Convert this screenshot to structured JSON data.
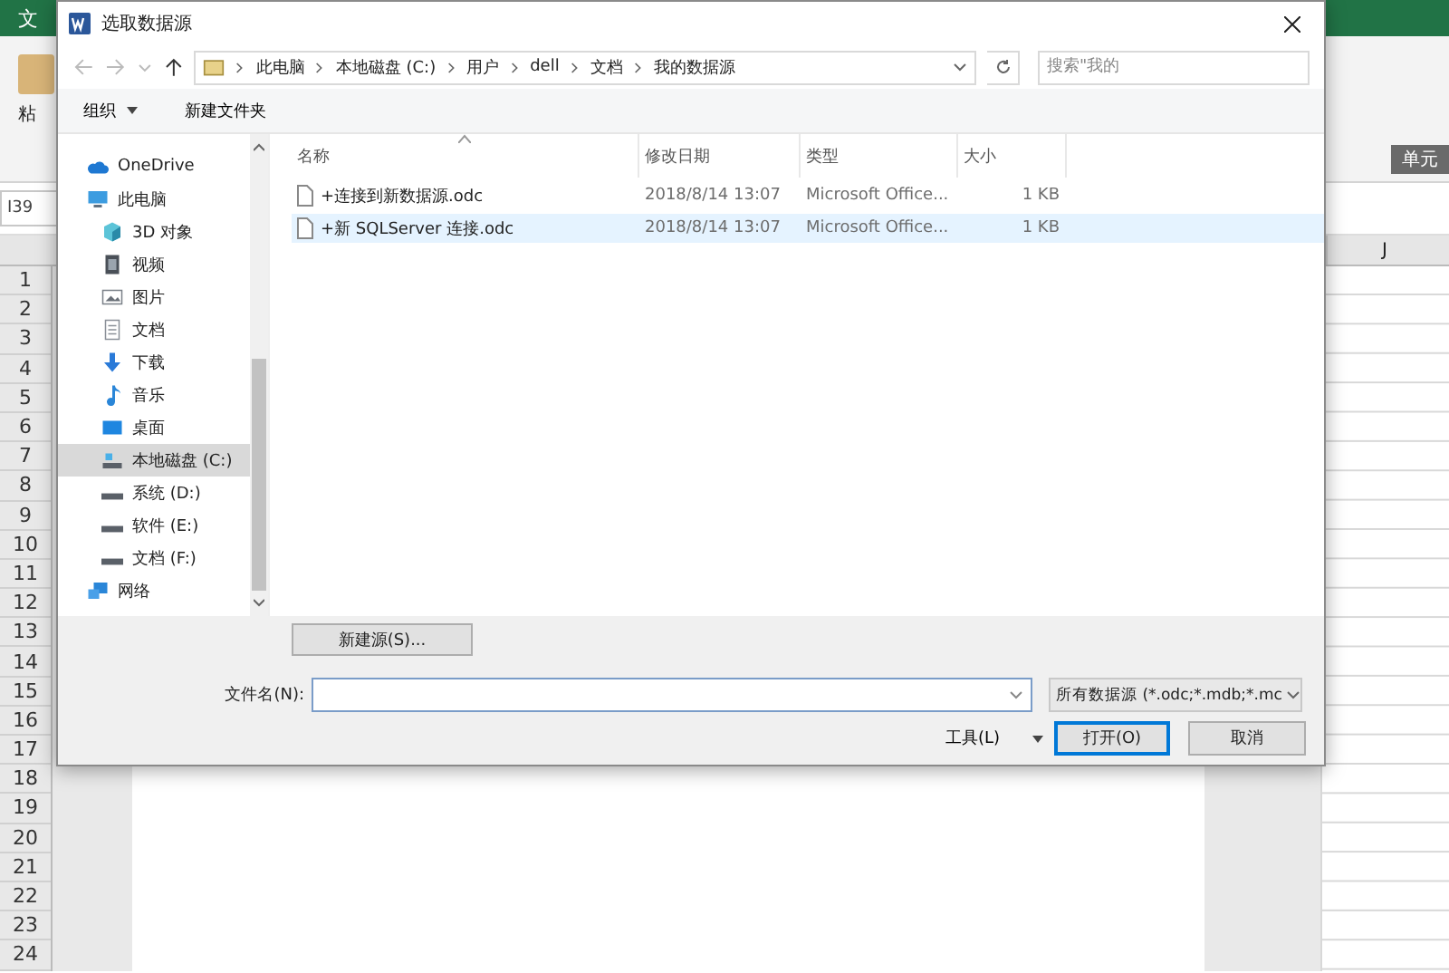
{
  "excel": {
    "tab_fragment": "文",
    "paste_fragment": "粘",
    "cell_group_fragment": "单元",
    "name_box": "I39",
    "column_header": "J",
    "row_numbers": [
      "1",
      "2",
      "3",
      "4",
      "5",
      "6",
      "7",
      "8",
      "9",
      "10",
      "11",
      "12",
      "13",
      "14",
      "15",
      "16",
      "17",
      "18",
      "19",
      "20",
      "21",
      "22",
      "23",
      "24"
    ]
  },
  "dialog": {
    "title": "选取数据源",
    "breadcrumb": [
      "此电脑",
      "本地磁盘 (C:)",
      "用户",
      "dell",
      "文档",
      "我的数据源"
    ],
    "search": {
      "placeholder": "搜索\"我的"
    },
    "toolbar": [
      {
        "label": "组织",
        "dropdown": true
      },
      {
        "label": "新建文件夹",
        "dropdown": false
      }
    ],
    "nav": [
      {
        "label": "OneDrive",
        "kind": "cloud",
        "selected": false
      },
      {
        "label": "此电脑",
        "kind": "computer",
        "selected": false,
        "children": [
          {
            "label": "3D 对象",
            "kind": "cube",
            "selected": false
          },
          {
            "label": "视频",
            "kind": "video",
            "selected": false
          },
          {
            "label": "图片",
            "kind": "image",
            "selected": false
          },
          {
            "label": "文档",
            "kind": "document",
            "selected": false
          },
          {
            "label": "下载",
            "kind": "download",
            "selected": false
          },
          {
            "label": "音乐",
            "kind": "music",
            "selected": false
          },
          {
            "label": "桌面",
            "kind": "desktop",
            "selected": false
          },
          {
            "label": "本地磁盘 (C:)",
            "kind": "system-drive",
            "selected": true
          },
          {
            "label": "系统 (D:)",
            "kind": "drive",
            "selected": false
          },
          {
            "label": "软件 (E:)",
            "kind": "drive",
            "selected": false
          },
          {
            "label": "文档 (F:)",
            "kind": "drive",
            "selected": false
          }
        ]
      },
      {
        "label": "网络",
        "kind": "network",
        "selected": false
      }
    ],
    "columns": [
      "名称",
      "修改日期",
      "类型",
      "大小"
    ],
    "files": [
      {
        "name": "+连接到新数据源.odc",
        "date": "2018/8/14 13:07",
        "type": "Microsoft Office...",
        "size": "1 KB",
        "hovered": false
      },
      {
        "name": "+新 SQLServer 连接.odc",
        "date": "2018/8/14 13:07",
        "type": "Microsoft Office...",
        "size": "1 KB",
        "hovered": true
      }
    ],
    "new_source_button": "新建源(S)...",
    "filename": {
      "label": "文件名(N):"
    },
    "filter": "所有数据源 (*.odc;*.mdb;*.mc",
    "tools": "工具(L)",
    "open_button": "打开(O)",
    "cancel_button": "取消"
  }
}
